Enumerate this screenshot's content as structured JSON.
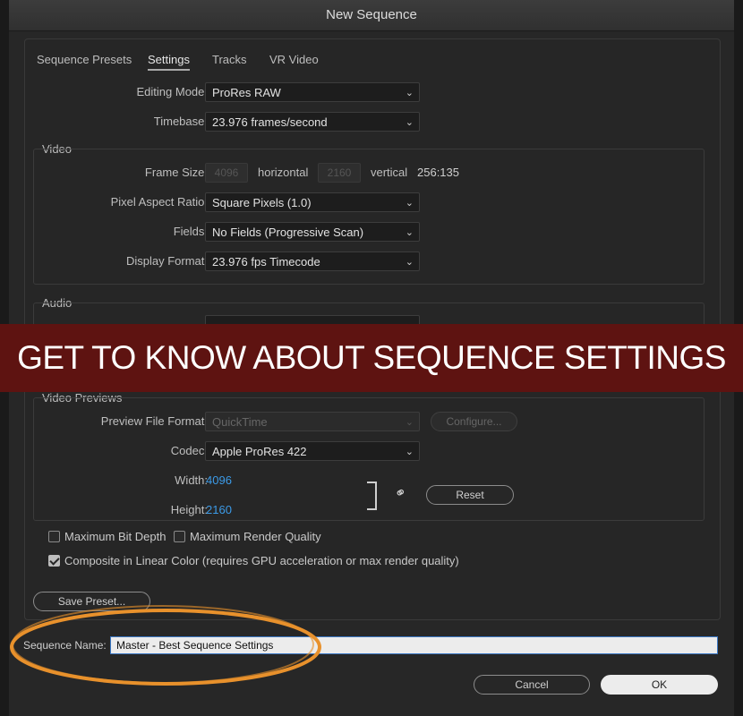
{
  "window": {
    "title": "New Sequence"
  },
  "tabs": [
    {
      "label": "Sequence Presets",
      "active": false
    },
    {
      "label": "Settings",
      "active": true
    },
    {
      "label": "Tracks",
      "active": false
    },
    {
      "label": "VR Video",
      "active": false
    }
  ],
  "settings": {
    "editing_mode": {
      "label": "Editing Mode:",
      "value": "ProRes RAW"
    },
    "timebase": {
      "label": "Timebase:",
      "value": "23.976  frames/second"
    }
  },
  "video": {
    "title": "Video",
    "frame_size": {
      "label": "Frame Size:",
      "width": "4096",
      "horizontal_label": "horizontal",
      "height": "2160",
      "vertical_label": "vertical",
      "ratio": "256:135"
    },
    "pixel_aspect": {
      "label": "Pixel Aspect Ratio:",
      "value": "Square Pixels (1.0)"
    },
    "fields": {
      "label": "Fields:",
      "value": "No Fields (Progressive Scan)"
    },
    "display_format": {
      "label": "Display Format:",
      "value": "23.976 fps Timecode"
    }
  },
  "audio": {
    "title": "Audio"
  },
  "banner": {
    "text": "GET TO KNOW ABOUT SEQUENCE SETTINGS"
  },
  "previews": {
    "title": "Video Previews",
    "file_format": {
      "label": "Preview File Format:",
      "value": "QuickTime"
    },
    "configure_label": "Configure...",
    "codec": {
      "label": "Codec:",
      "value": "Apple ProRes 422"
    },
    "width": {
      "label": "Width:",
      "value": "4096"
    },
    "height": {
      "label": "Height:",
      "value": "2160"
    },
    "reset_label": "Reset"
  },
  "options": {
    "max_bit_depth": {
      "label": "Maximum Bit Depth",
      "checked": false
    },
    "max_render_quality": {
      "label": "Maximum Render Quality",
      "checked": false
    },
    "linear_color": {
      "label": "Composite in Linear Color (requires GPU acceleration or max render quality)",
      "checked": true
    }
  },
  "save_preset_label": "Save Preset...",
  "sequence_name": {
    "label": "Sequence Name:",
    "value": "Master - Best Sequence Settings"
  },
  "footer": {
    "cancel_label": "Cancel",
    "ok_label": "OK"
  },
  "colors": {
    "banner": "#5e1311",
    "highlight_ellipse": "#e8912c",
    "value_blue": "#3c9be8"
  }
}
